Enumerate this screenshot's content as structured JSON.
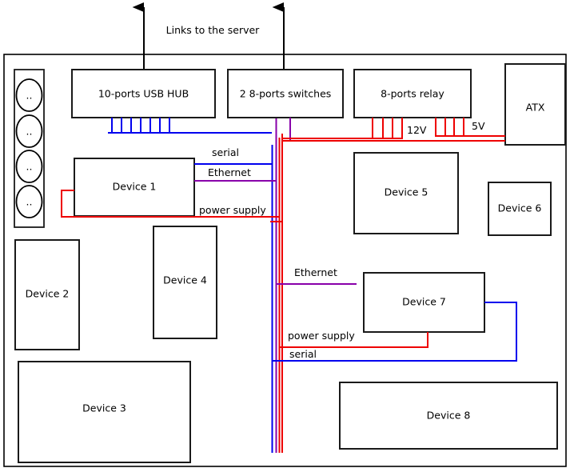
{
  "diagram": {
    "title": "Links to the server",
    "enclosure_label": "rack-enclosure",
    "top_row": [
      {
        "id": "usb-hub",
        "label": "10-ports USB HUB"
      },
      {
        "id": "switches",
        "label": "2 8-ports switches"
      },
      {
        "id": "relay",
        "label": "8-ports relay"
      },
      {
        "id": "atx",
        "label": "ATX"
      }
    ],
    "devices": [
      {
        "id": "device-1",
        "label": "Device 1"
      },
      {
        "id": "device-2",
        "label": "Device 2"
      },
      {
        "id": "device-3",
        "label": "Device 3"
      },
      {
        "id": "device-4",
        "label": "Device 4"
      },
      {
        "id": "device-5",
        "label": "Device 5"
      },
      {
        "id": "device-6",
        "label": "Device 6"
      },
      {
        "id": "device-7",
        "label": "Device 7"
      },
      {
        "id": "device-8",
        "label": "Device 8"
      }
    ],
    "slot_bay": {
      "slot_count": 4,
      "slot_text": ".."
    },
    "wire_labels": {
      "serial_top": "serial",
      "ethernet_top": "Ethernet",
      "power_supply_top": "power supply",
      "ethernet_mid": "Ethernet",
      "power_supply_bottom": "power supply",
      "serial_bottom": "serial",
      "rail_12v": "12V",
      "rail_5v": "5V"
    },
    "colors": {
      "serial": "#0000ee",
      "ethernet": "#8800aa",
      "power": "#ee0000",
      "outline": "#1a1a1a",
      "background": "#ffffff"
    },
    "relay_pins": {
      "rail_12v_count": 4,
      "rail_5v_count": 4
    },
    "usb_hub_pins": {
      "count": 7
    }
  }
}
